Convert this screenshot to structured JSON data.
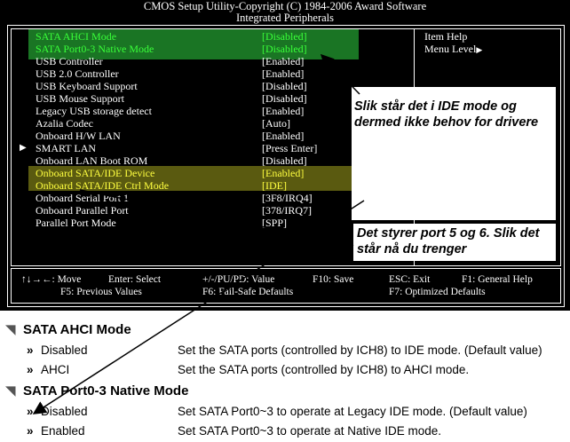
{
  "header": {
    "title_line1": "CMOS Setup Utility-Copyright (C) 1984-2006 Award Software",
    "title_line2": "Integrated Peripherals"
  },
  "settings": [
    {
      "label": "SATA AHCI Mode",
      "value": "[Disabled]"
    },
    {
      "label": "SATA Port0-3 Native Mode",
      "value": "[Disabled]"
    },
    {
      "label": "USB Controller",
      "value": "[Enabled]"
    },
    {
      "label": "USB 2.0 Controller",
      "value": "[Enabled]"
    },
    {
      "label": "USB Keyboard Support",
      "value": "[Disabled]"
    },
    {
      "label": "USB Mouse Support",
      "value": "[Disabled]"
    },
    {
      "label": "Legacy USB storage detect",
      "value": "[Enabled]"
    },
    {
      "label": "Azalia Codec",
      "value": "[Auto]"
    },
    {
      "label": "Onboard H/W LAN",
      "value": "[Enabled]"
    },
    {
      "label": "SMART LAN",
      "value": "[Press Enter]"
    },
    {
      "label": "Onboard LAN Boot ROM",
      "value": "[Disabled]"
    },
    {
      "label": "Onboard SATA/IDE Device",
      "value": "[Enabled]"
    },
    {
      "label": "Onboard SATA/IDE Ctrl Mode",
      "value": "[IDE]"
    },
    {
      "label": "Onboard Serial Port 1",
      "value": "[3F8/IRQ4]"
    },
    {
      "label": "Onboard Parallel Port",
      "value": "[378/IRQ7]"
    },
    {
      "label": "Parallel Port Mode",
      "value": "[SPP]"
    }
  ],
  "help_panel": {
    "item_help": "Item Help",
    "menu_level": "Menu Level"
  },
  "annotations": {
    "note1": "Slik står det i IDE mode og dermed ikke behov for drivere",
    "note2": "Det styrer port 5 og 6. Slik det står nå du trenger"
  },
  "keys": {
    "move": "↑↓→←: Move",
    "select": "Enter: Select",
    "value": "+/-/PU/PD: Value",
    "save": "F10: Save",
    "exit": "ESC: Exit",
    "help": "F1: General Help",
    "prev": "F5: Previous Values",
    "failsafe": "F6: Fail-Safe Defaults",
    "optimized": "F7: Optimized Defaults"
  },
  "doc": {
    "section1_title": "SATA AHCI Mode",
    "section1_opt1": "Disabled",
    "section1_desc1": "Set the SATA ports (controlled by ICH8) to IDE mode. (Default value)",
    "section1_opt2": "AHCI",
    "section1_desc2": "Set the SATA ports (controlled by ICH8) to AHCI mode.",
    "section2_title": "SATA Port0-3 Native Mode",
    "section2_opt1": "Disabled",
    "section2_desc1": "Set SATA Port0~3 to operate at Legacy IDE mode. (Default value)",
    "section2_opt2": "Enabled",
    "section2_desc2": "Set SATA Port0~3 to operate at Native IDE mode."
  },
  "colors": {
    "bios_bg": "#000000",
    "bios_text": "#ffffff",
    "highlight_green": "#39ff39",
    "highlight_yellow": "#ffff40"
  }
}
